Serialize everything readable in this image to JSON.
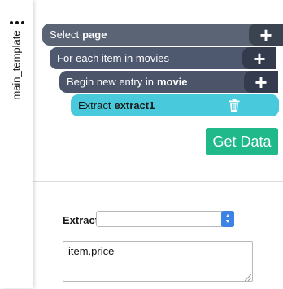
{
  "sidebar": {
    "tab_label": "main_template"
  },
  "commands": [
    {
      "prefix": "Select",
      "value": "page"
    },
    {
      "prefix": "For each item in movies",
      "value": ""
    },
    {
      "prefix": "Begin new entry in",
      "value": "movie"
    },
    {
      "prefix": "Extract",
      "value": "extract1"
    }
  ],
  "get_data_button": "Get Data",
  "extract_panel": {
    "label": "Extract",
    "select_value": "",
    "expression": "item.price"
  },
  "colors": {
    "dark_row": "#5a6475",
    "active_row": "#49c9dc",
    "get_data": "#1fb98a",
    "select_arrow": "#3d83e6"
  }
}
